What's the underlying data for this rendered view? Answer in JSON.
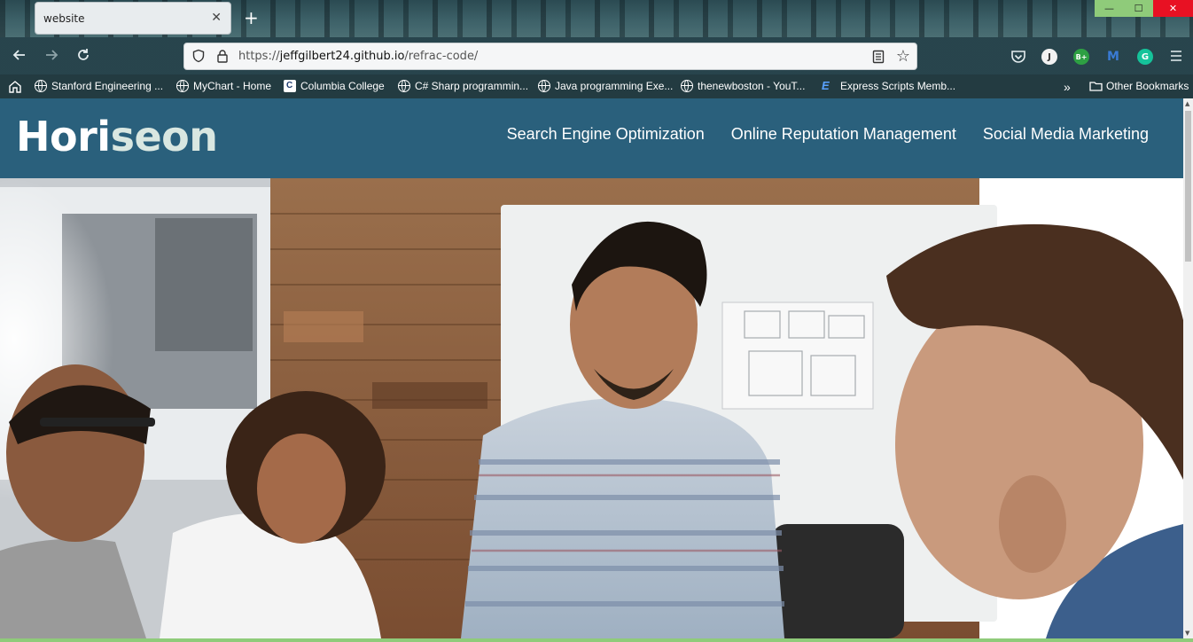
{
  "browser": {
    "tab_title": "website",
    "tab_close": "✕",
    "new_tab": "+",
    "url_prefix": "https://",
    "url_host": "jeffgilbert24.github.io",
    "url_path": "/refrac-code/",
    "window_controls": {
      "minimize": "—",
      "maximize": "☐",
      "close": "✕"
    },
    "toolbar_icons": [
      "pocket-icon",
      "profile-icon",
      "extension-icon",
      "extension-icon",
      "grammarly-icon",
      "menu-icon"
    ],
    "profile_initial": "J",
    "ext1_label": "B+",
    "ext2_label": "M",
    "ext3_label": "G"
  },
  "bookmarks": {
    "items": [
      {
        "label": "Stanford Engineering ..."
      },
      {
        "label": "MyChart - Home"
      },
      {
        "label": "Columbia College"
      },
      {
        "label": "C# Sharp programmin..."
      },
      {
        "label": "Java programming Exe..."
      },
      {
        "label": "thenewboston - YouT..."
      },
      {
        "label": "Express Scripts Memb..."
      }
    ],
    "more": "»",
    "other": "Other Bookmarks"
  },
  "site": {
    "logo_main": "Hori",
    "logo_accent": "seon",
    "nav": [
      {
        "label": "Search Engine Optimization"
      },
      {
        "label": "Online Reputation Management"
      },
      {
        "label": "Social Media Marketing"
      }
    ],
    "colors": {
      "header": "#2a607c",
      "logo_accent": "#d9e7e1"
    }
  }
}
